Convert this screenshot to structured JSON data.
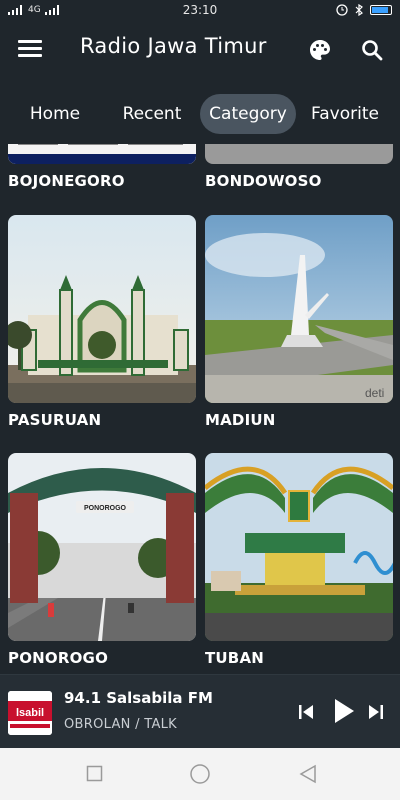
{
  "status": {
    "carrier": "4G",
    "time": "23:10"
  },
  "app": {
    "title": "Radio Jawa Timur"
  },
  "tabs": [
    {
      "label": "Home"
    },
    {
      "label": "Recent"
    },
    {
      "label": "Category"
    },
    {
      "label": "Favorite"
    }
  ],
  "categories": [
    {
      "name": "BOJONEGORO"
    },
    {
      "name": "BONDOWOSO"
    },
    {
      "name": "PASURUAN"
    },
    {
      "name": "MADIUN"
    },
    {
      "name": "PONOROGO"
    },
    {
      "name": "TUBAN"
    }
  ],
  "player": {
    "station": "94.1 Salsabila FM",
    "genre": "OBROLAN / TALK",
    "art_text": "lsabil"
  },
  "photos": {
    "madiun_watermark": "deti",
    "ponorogo_sign": "PONOROGO"
  },
  "colors": {
    "background": "#1f262c",
    "active_tab": "#4a5560"
  }
}
